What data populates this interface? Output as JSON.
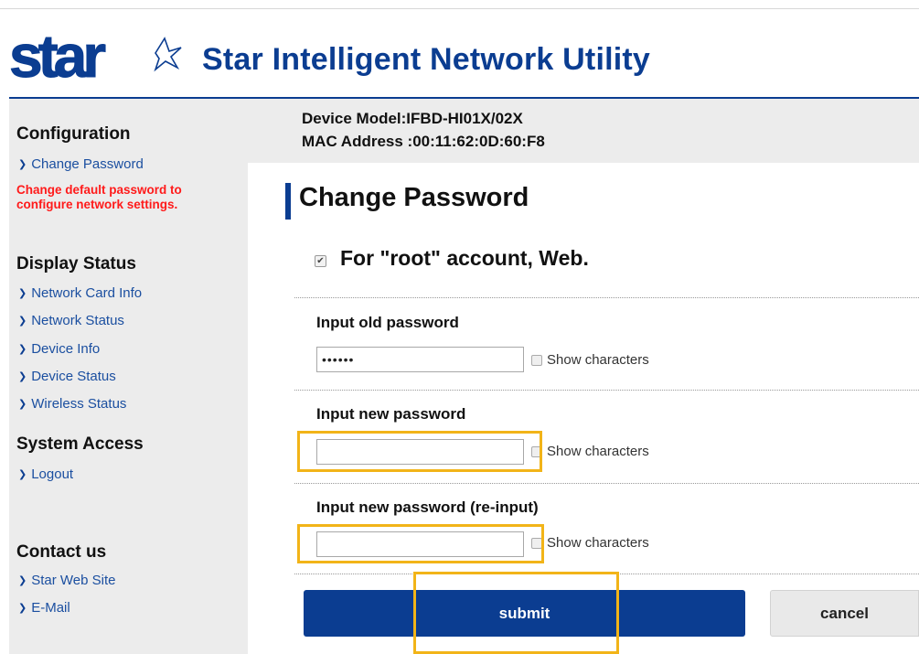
{
  "header": {
    "logo_text": "star",
    "title": "Star Intelligent Network Utility"
  },
  "sidebar": {
    "configuration": {
      "title": "Configuration",
      "links": [
        {
          "label": "Change Password",
          "icon": "chevron-right-icon"
        }
      ],
      "warning": "Change default password to configure network settings."
    },
    "display_status": {
      "title": "Display Status",
      "links": [
        {
          "label": "Network Card Info",
          "icon": "chevron-right-icon"
        },
        {
          "label": "Network Status",
          "icon": "chevron-right-icon"
        },
        {
          "label": "Device Info",
          "icon": "chevron-right-icon"
        },
        {
          "label": "Device Status",
          "icon": "chevron-right-icon"
        },
        {
          "label": "Wireless Status",
          "icon": "chevron-right-icon"
        }
      ]
    },
    "system_access": {
      "title": "System Access",
      "links": [
        {
          "label": "Logout",
          "icon": "chevron-right-icon"
        }
      ]
    },
    "contact": {
      "title": "Contact us",
      "links": [
        {
          "label": "Star Web Site",
          "icon": "chevron-right-icon"
        },
        {
          "label": "E-Mail",
          "icon": "chevron-right-icon"
        }
      ]
    }
  },
  "device": {
    "model_line": "Device Model:IFBD-HI01X/02X",
    "mac_line": "MAC Address :00:11:62:0D:60:F8"
  },
  "main": {
    "page_title": "Change Password",
    "account_checked": true,
    "account_label": "For \"root\" account, Web.",
    "fields": [
      {
        "label": "Input old password",
        "value": "••••••",
        "show_label": "Show characters",
        "show_checked": false
      },
      {
        "label": "Input new password",
        "value": "",
        "show_label": "Show characters",
        "show_checked": false
      },
      {
        "label": "Input new password (re-input)",
        "value": "",
        "show_label": "Show characters",
        "show_checked": false
      }
    ],
    "submit_label": "submit",
    "cancel_label": "cancel"
  },
  "colors": {
    "brand_blue": "#0b3d91",
    "warning_red": "#ff1a1a",
    "highlight_yellow": "#f2b418",
    "sidebar_gray": "#ececec"
  }
}
